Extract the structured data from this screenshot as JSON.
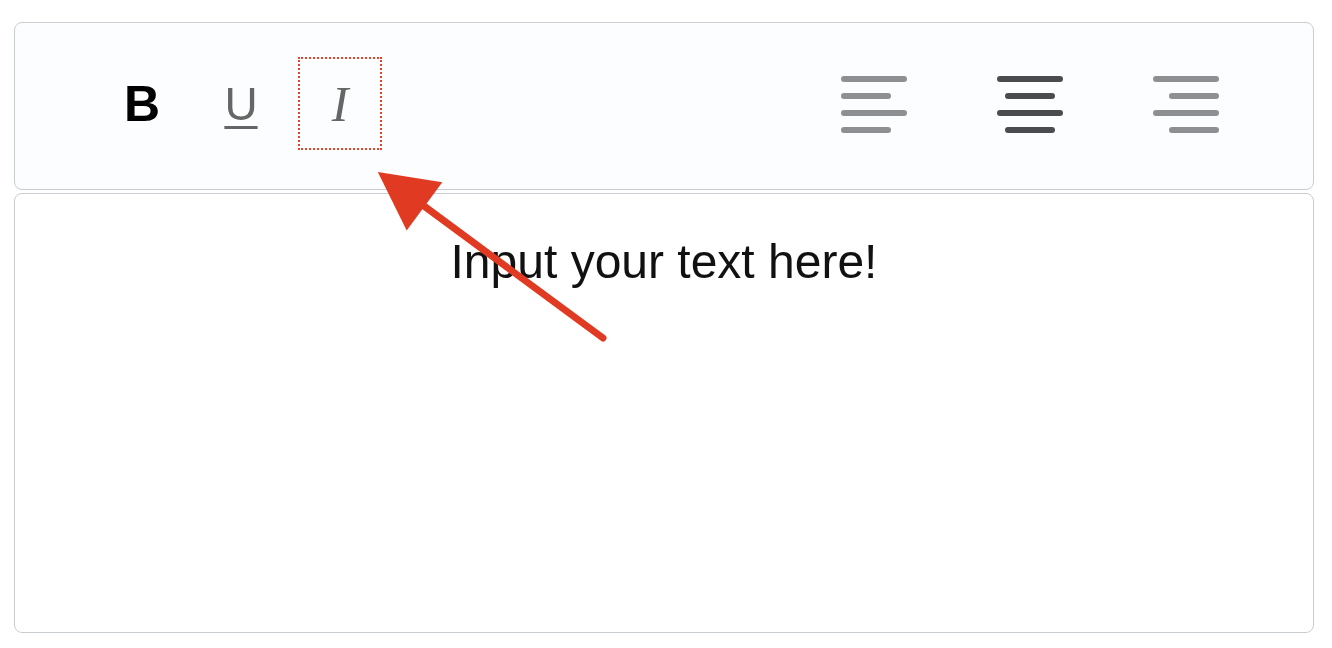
{
  "toolbar": {
    "format_buttons": [
      {
        "kind": "bold",
        "label": "B",
        "selected": true,
        "highlighted": false
      },
      {
        "kind": "underline",
        "label": "U",
        "selected": false,
        "highlighted": false
      },
      {
        "kind": "italic",
        "label": "I",
        "selected": false,
        "highlighted": true
      }
    ],
    "align_buttons": [
      {
        "kind": "left",
        "selected": false
      },
      {
        "kind": "center",
        "selected": true
      },
      {
        "kind": "right",
        "selected": false
      }
    ]
  },
  "editor": {
    "placeholder": "Input your text here!"
  }
}
